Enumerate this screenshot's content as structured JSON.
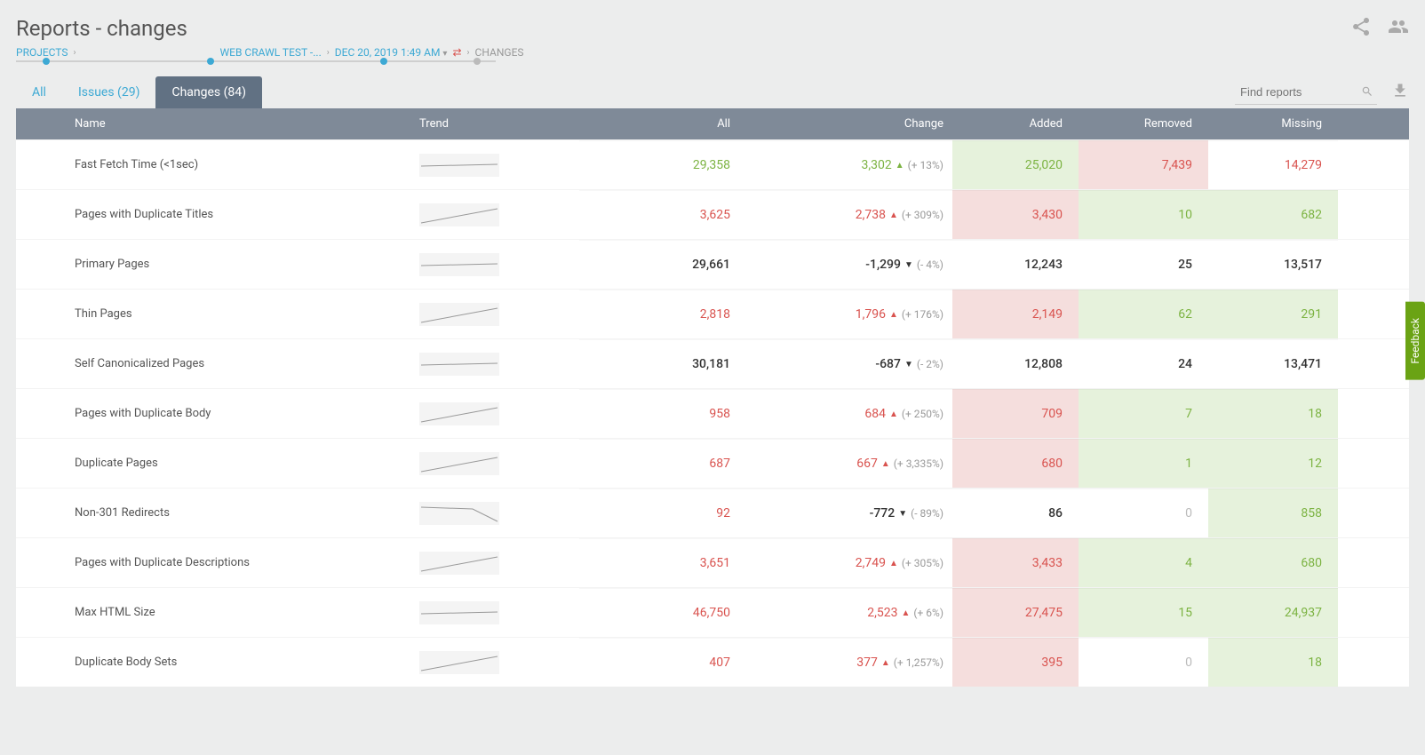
{
  "page_title": "Reports - changes",
  "breadcrumb": {
    "projects": "PROJECTS",
    "crawl": "WEB CRAWL TEST -...",
    "date": "DEC 20, 2019 1:49 AM",
    "current": "CHANGES"
  },
  "tabs": {
    "all": "All",
    "issues": "Issues (29)",
    "changes": "Changes (84)"
  },
  "search": {
    "placeholder": "Find reports"
  },
  "columns": {
    "name": "Name",
    "trend": "Trend",
    "all": "All",
    "change": "Change",
    "added": "Added",
    "removed": "Removed",
    "missing": "Missing"
  },
  "feedback_label": "Feedback",
  "rows": [
    {
      "name": "Fast Fetch Time (<1sec)",
      "trend": "flat",
      "all": "29,358",
      "all_color": "green",
      "change": "3,302",
      "change_color": "green",
      "dir": "up",
      "pct": "(+ 13%)",
      "added": "25,020",
      "added_bg": "green",
      "added_color": "green",
      "removed": "7,439",
      "removed_bg": "red",
      "removed_color": "red",
      "missing": "14,279",
      "missing_bg": "white",
      "missing_color": "red"
    },
    {
      "name": "Pages with Duplicate Titles",
      "trend": "up",
      "all": "3,625",
      "all_color": "red",
      "change": "2,738",
      "change_color": "red",
      "dir": "up",
      "pct": "(+ 309%)",
      "added": "3,430",
      "added_bg": "red",
      "added_color": "red",
      "removed": "10",
      "removed_bg": "green",
      "removed_color": "green",
      "missing": "682",
      "missing_bg": "green",
      "missing_color": "green"
    },
    {
      "name": "Primary Pages",
      "trend": "flat",
      "all": "29,661",
      "all_color": "black",
      "change": "-1,299",
      "change_color": "black",
      "dir": "down",
      "pct": "(- 4%)",
      "added": "12,243",
      "added_bg": "white",
      "added_color": "black",
      "removed": "25",
      "removed_bg": "white",
      "removed_color": "black",
      "missing": "13,517",
      "missing_bg": "white",
      "missing_color": "black"
    },
    {
      "name": "Thin Pages",
      "trend": "up",
      "all": "2,818",
      "all_color": "red",
      "change": "1,796",
      "change_color": "red",
      "dir": "up",
      "pct": "(+ 176%)",
      "added": "2,149",
      "added_bg": "red",
      "added_color": "red",
      "removed": "62",
      "removed_bg": "green",
      "removed_color": "green",
      "missing": "291",
      "missing_bg": "green",
      "missing_color": "green"
    },
    {
      "name": "Self Canonicalized Pages",
      "trend": "flat",
      "all": "30,181",
      "all_color": "black",
      "change": "-687",
      "change_color": "black",
      "dir": "down",
      "pct": "(- 2%)",
      "added": "12,808",
      "added_bg": "white",
      "added_color": "black",
      "removed": "24",
      "removed_bg": "white",
      "removed_color": "black",
      "missing": "13,471",
      "missing_bg": "white",
      "missing_color": "black"
    },
    {
      "name": "Pages with Duplicate Body",
      "trend": "up",
      "all": "958",
      "all_color": "red",
      "change": "684",
      "change_color": "red",
      "dir": "up",
      "pct": "(+ 250%)",
      "added": "709",
      "added_bg": "red",
      "added_color": "red",
      "removed": "7",
      "removed_bg": "green",
      "removed_color": "green",
      "missing": "18",
      "missing_bg": "green",
      "missing_color": "green"
    },
    {
      "name": "Duplicate Pages",
      "trend": "up",
      "all": "687",
      "all_color": "red",
      "change": "667",
      "change_color": "red",
      "dir": "up",
      "pct": "(+ 3,335%)",
      "added": "680",
      "added_bg": "red",
      "added_color": "red",
      "removed": "1",
      "removed_bg": "green",
      "removed_color": "green",
      "missing": "12",
      "missing_bg": "green",
      "missing_color": "green"
    },
    {
      "name": "Non-301 Redirects",
      "trend": "down",
      "all": "92",
      "all_color": "red",
      "change": "-772",
      "change_color": "black",
      "dir": "down",
      "pct": "(- 89%)",
      "added": "86",
      "added_bg": "white",
      "added_color": "black",
      "removed": "0",
      "removed_bg": "white",
      "removed_color": "zero",
      "missing": "858",
      "missing_bg": "green",
      "missing_color": "green"
    },
    {
      "name": "Pages with Duplicate Descriptions",
      "trend": "up",
      "all": "3,651",
      "all_color": "red",
      "change": "2,749",
      "change_color": "red",
      "dir": "up",
      "pct": "(+ 305%)",
      "added": "3,433",
      "added_bg": "red",
      "added_color": "red",
      "removed": "4",
      "removed_bg": "green",
      "removed_color": "green",
      "missing": "680",
      "missing_bg": "green",
      "missing_color": "green"
    },
    {
      "name": "Max HTML Size",
      "trend": "flat",
      "all": "46,750",
      "all_color": "red",
      "change": "2,523",
      "change_color": "red",
      "dir": "up",
      "pct": "(+ 6%)",
      "added": "27,475",
      "added_bg": "red",
      "added_color": "red",
      "removed": "15",
      "removed_bg": "green",
      "removed_color": "green",
      "missing": "24,937",
      "missing_bg": "green",
      "missing_color": "green"
    },
    {
      "name": "Duplicate Body Sets",
      "trend": "up",
      "all": "407",
      "all_color": "red",
      "change": "377",
      "change_color": "red",
      "dir": "up",
      "pct": "(+ 1,257%)",
      "added": "395",
      "added_bg": "red",
      "added_color": "red",
      "removed": "0",
      "removed_bg": "white",
      "removed_color": "zero",
      "missing": "18",
      "missing_bg": "green",
      "missing_color": "green"
    }
  ]
}
